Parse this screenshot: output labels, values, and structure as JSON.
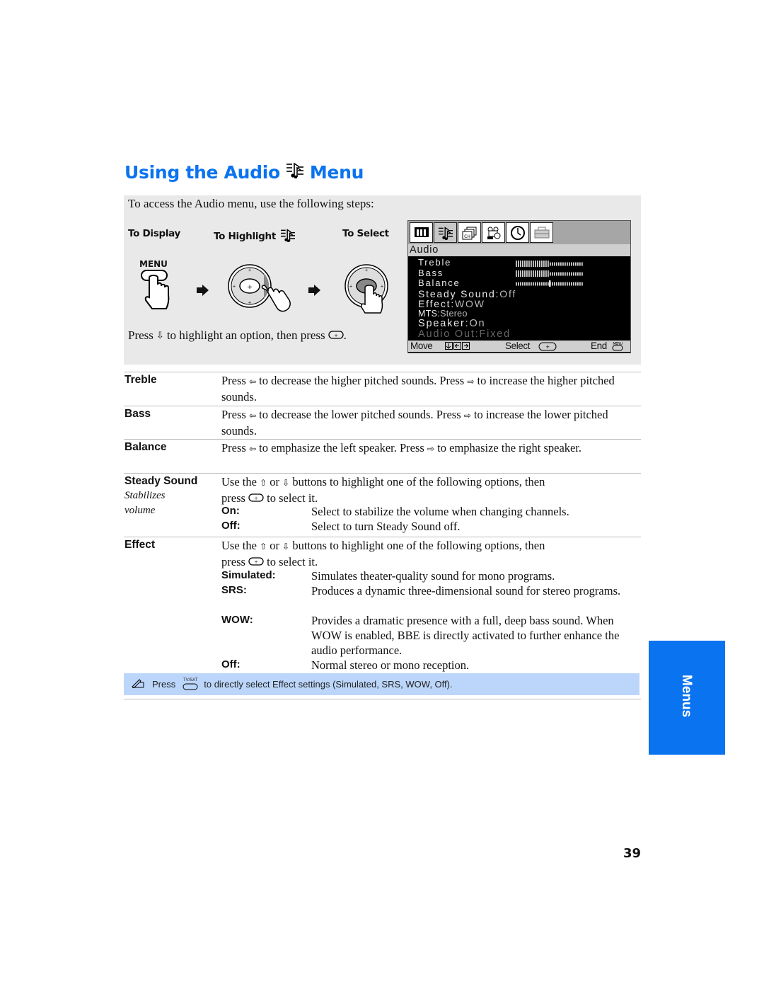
{
  "page": {
    "title_prefix": "Using the Audio",
    "title_suffix": "Menu",
    "title_icon": "audio-notes-icon",
    "page_number": "39",
    "side_tab_label": "Menus",
    "accent_color": "#0a73ef"
  },
  "steps": {
    "intro": "To access the Audio menu, use the following steps:",
    "labels": [
      "To Display",
      "To Highlight",
      "To Select"
    ],
    "menu_button_label": "MENU",
    "press_line_prefix": "Press",
    "press_line_middle": "to highlight an option, then press",
    "press_line_end": "."
  },
  "osd": {
    "tabs": [
      "video-icon",
      "audio-icon",
      "channel-icon",
      "parent-icon",
      "timer-icon",
      "setup-icon"
    ],
    "active_tab": 1,
    "header": "Audio",
    "rows": [
      {
        "label": "Treble",
        "value": "",
        "level": 0.5,
        "type": "bar"
      },
      {
        "label": "Bass",
        "value": "",
        "level": 0.5,
        "type": "bar"
      },
      {
        "label": "Balance",
        "value": "",
        "level": 0.5,
        "type": "center"
      },
      {
        "label": "Steady Sound:",
        "value": "Off"
      },
      {
        "label": "Effect:",
        "value": "WOW"
      },
      {
        "label": "MTS:",
        "value": "Stereo"
      },
      {
        "label": "Speaker:",
        "value": "On"
      },
      {
        "label": "Audio Out:",
        "value": "Fixed",
        "disabled": true
      }
    ],
    "footer": {
      "move": "Move",
      "select": "Select",
      "end": "End",
      "end_btn": "MENU"
    }
  },
  "items": [
    {
      "term": "Treble",
      "desc": [
        "Press",
        "to decrease the higher pitched sounds. Press",
        "to increase the higher pitched sounds."
      ]
    },
    {
      "term": "Bass",
      "desc": [
        "Press",
        "to decrease the lower pitched sounds. Press",
        "to increase the lower pitched sounds."
      ]
    },
    {
      "term": "Balance",
      "desc": [
        "Press",
        "to emphasize the left speaker. Press",
        "to emphasize the right speaker."
      ]
    },
    {
      "term": "Steady Sound",
      "subtitle": [
        "Stabilizes",
        "volume"
      ],
      "intro": [
        "Use the",
        "or",
        "buttons to highlight one of the following options, then",
        "press",
        "to select it."
      ],
      "options": [
        {
          "term": "On:",
          "desc": "Select to stabilize the volume when changing channels."
        },
        {
          "term": "Off:",
          "desc": "Select to turn Steady Sound off."
        }
      ]
    },
    {
      "term": "Effect",
      "intro": [
        "Use the",
        "or",
        "buttons to highlight one of the following options, then",
        "press",
        "to select it."
      ],
      "options": [
        {
          "term": "Simulated:",
          "desc": "Simulates theater-quality sound for mono programs."
        },
        {
          "term": "SRS:",
          "desc": "Produces a dynamic three-dimensional sound for stereo programs."
        },
        {
          "term": "WOW:",
          "desc": "Provides a dramatic presence with a full, deep bass sound. When WOW is enabled, BBE is directly activated to further enhance the audio performance."
        },
        {
          "term": "Off:",
          "desc": "Normal stereo or mono reception."
        }
      ]
    }
  ],
  "tip": {
    "prefix": "Press",
    "button_label": "TV/SAT",
    "text": "to directly select Effect settings (Simulated, SRS, WOW, Off)."
  }
}
